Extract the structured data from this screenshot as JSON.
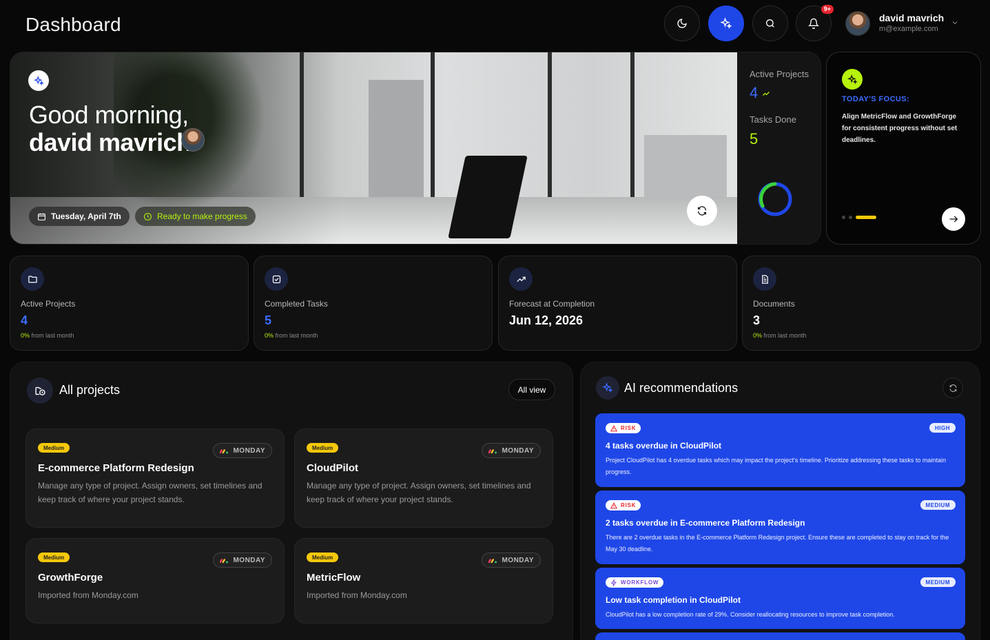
{
  "header": {
    "title": "Dashboard",
    "notification_badge": "9+",
    "user": {
      "name": "david mavrich",
      "email": "m@example.com"
    },
    "icons": [
      "moon-icon",
      "sparkle-icon",
      "search-icon",
      "bell-icon",
      "chevron-down-icon"
    ]
  },
  "hero": {
    "greeting_line1": "Good morning,",
    "greeting_line2": "david mavrich!",
    "date": "Tuesday, April 7th",
    "ready": "Ready to make progress",
    "side": {
      "active_projects_label": "Active Projects",
      "active_projects_value": "4",
      "tasks_done_label": "Tasks Done",
      "tasks_done_value": "5"
    }
  },
  "focus": {
    "title": "TODAY'S FOCUS:",
    "text": "Align MetricFlow and GrowthForge for consistent progress without set deadlines."
  },
  "stats": [
    {
      "label": "Active Projects",
      "value": "4",
      "pct": "0%",
      "sub": "from last month",
      "icon": "folder-icon"
    },
    {
      "label": "Completed Tasks",
      "value": "5",
      "pct": "0%",
      "sub": "from last month",
      "icon": "check-square-icon"
    },
    {
      "label": "Forecast at Completion",
      "value": "Jun 12, 2026",
      "icon": "trending-up-icon"
    },
    {
      "label": "Documents",
      "value": "3",
      "pct": "0%",
      "sub": "from last month",
      "icon": "document-icon"
    }
  ],
  "projects_panel": {
    "title": "All projects",
    "all_view": "All view",
    "projects": [
      {
        "priority": "Medium",
        "source": "MONDAY",
        "name": "E-commerce Platform Redesign",
        "desc": "Manage any type of project. Assign owners, set timelines and keep track of where your project stands."
      },
      {
        "priority": "Medium",
        "source": "MONDAY",
        "name": "CloudPilot",
        "desc": "Manage any type of project. Assign owners, set timelines and keep track of where your project stands."
      },
      {
        "priority": "Medium",
        "source": "MONDAY",
        "name": "GrowthForge",
        "desc": "Imported from Monday.com"
      },
      {
        "priority": "Medium",
        "source": "MONDAY",
        "name": "MetricFlow",
        "desc": "Imported from Monday.com"
      }
    ]
  },
  "ai_panel": {
    "title": "AI recommendations",
    "recs": [
      {
        "tag": "RISK",
        "severity": "HIGH",
        "title": "4 tasks overdue in CloudPilot",
        "desc": "Project CloudPilot has 4 overdue tasks which may impact the project's timeline. Prioritize addressing these tasks to maintain progress."
      },
      {
        "tag": "RISK",
        "severity": "MEDIUM",
        "title": "2 tasks overdue in E-commerce Platform Redesign",
        "desc": "There are 2 overdue tasks in the E-commerce Platform Redesign project. Ensure these are completed to stay on track for the May 30 deadline."
      },
      {
        "tag": "WORKFLOW",
        "severity": "MEDIUM",
        "title": "Low task completion in CloudPilot",
        "desc": "CloudPilot has a low completion rate of 29%. Consider reallocating resources to improve task completion."
      }
    ]
  },
  "colors": {
    "accent": "#1f47e8",
    "lime": "#b6f20c",
    "yellow": "#f4c80b",
    "bg": "#080808"
  }
}
